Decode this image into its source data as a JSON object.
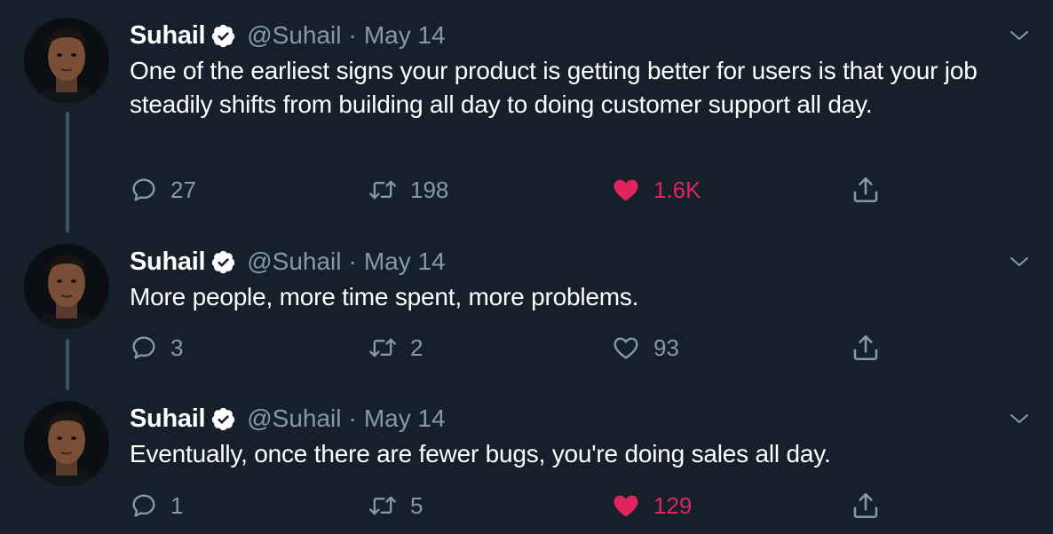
{
  "colors": {
    "background": "#15202b",
    "primary_text": "#ffffff",
    "secondary_text": "#8899a6",
    "like_active": "#e0245e",
    "verified_badge": "#ffffff",
    "thread_line": "#3d5466"
  },
  "icons": {
    "reply": "speech-bubble-icon",
    "retweet": "retweet-arrows-icon",
    "like": "heart-icon",
    "share": "share-upload-icon",
    "verified": "verified-badge-icon",
    "caret": "chevron-down-icon"
  },
  "tweets": [
    {
      "author": {
        "name": "Suhail",
        "handle": "@Suhail",
        "verified": true
      },
      "separator": "·",
      "date": "May 14",
      "text": "One of the earliest signs your product is getting better for users is that your job steadily shifts from building all day to doing customer support all day.",
      "replies": "27",
      "retweets": "198",
      "likes": "1.6K",
      "liked": true
    },
    {
      "author": {
        "name": "Suhail",
        "handle": "@Suhail",
        "verified": true
      },
      "separator": "·",
      "date": "May 14",
      "text": "More people, more time spent, more problems.",
      "replies": "3",
      "retweets": "2",
      "likes": "93",
      "liked": false
    },
    {
      "author": {
        "name": "Suhail",
        "handle": "@Suhail",
        "verified": true
      },
      "separator": "·",
      "date": "May 14",
      "text": "Eventually, once there are fewer bugs, you're doing sales all day.",
      "replies": "1",
      "retweets": "5",
      "likes": "129",
      "liked": true
    }
  ]
}
